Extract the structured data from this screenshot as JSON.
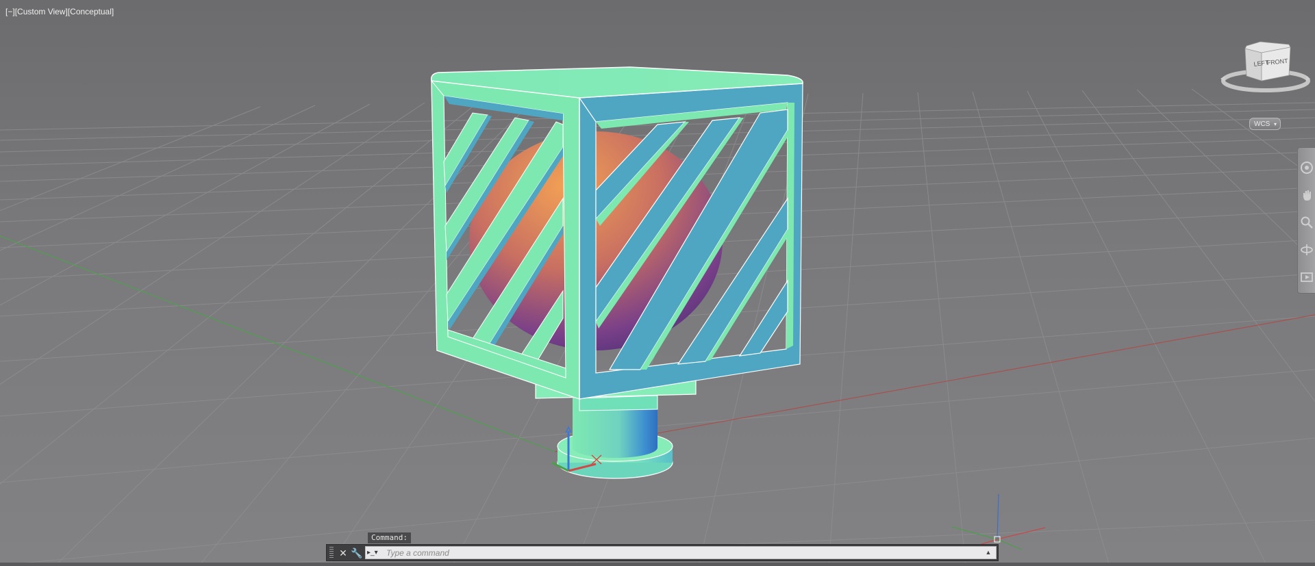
{
  "viewport": {
    "label": {
      "controls": "[−]",
      "view": "[Custom View]",
      "visual_style": "[Conceptual]"
    }
  },
  "viewcube": {
    "left_face": "LEFT",
    "front_face": "FRONT"
  },
  "wcs": {
    "label": "WCS"
  },
  "navigation_bar": {
    "items": [
      "steering-wheel-icon",
      "pan-icon",
      "zoom-icon",
      "orbit-icon",
      "showmotion-icon"
    ]
  },
  "command_line": {
    "label": "Command:",
    "placeholder": "Type a command"
  },
  "scene": {
    "object": "lattice cube lamp with sphere on cylindrical base",
    "colors": {
      "cube_face_green": "#7de8b0",
      "cube_face_blue": "#4fa6c2",
      "sphere_orange": "#e99550",
      "sphere_purple": "#6b3f8f",
      "grid_line": "#909092",
      "axis_x": "#b05050",
      "axis_y": "#4a9a4a"
    }
  }
}
